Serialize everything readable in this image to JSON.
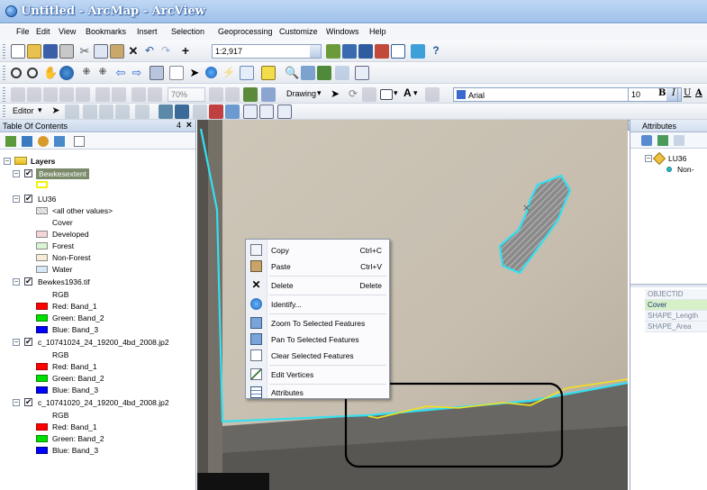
{
  "window": {
    "title": "Untitled - ArcMap - ArcView"
  },
  "menu": [
    "File",
    "Edit",
    "View",
    "Bookmarks",
    "Insert",
    "Selection",
    "Geoprocessing",
    "Customize",
    "Windows",
    "Help"
  ],
  "toolbar": {
    "scale_value": "1:2,917",
    "zoom_percent": "70%",
    "drawing_label": "Drawing",
    "font_name": "Arial",
    "font_size": "10",
    "bold": "B",
    "italic": "I",
    "underline": "U",
    "font_color_label": "A",
    "editor_label": "Editor"
  },
  "toc": {
    "title": "Table Of Contents",
    "pin": "4",
    "close": "×",
    "root_label": "Layers",
    "layers": [
      {
        "name": "Bewkesextent",
        "selected": true
      },
      {
        "name": "LU36",
        "other_values": "<all other values>",
        "field": "Cover",
        "classes": [
          {
            "label": "Developed",
            "color": "#f6d5d8"
          },
          {
            "label": "Forest",
            "color": "#d9f4d3"
          },
          {
            "label": "Non-Forest",
            "color": "#f8ecd6"
          },
          {
            "label": "Water",
            "color": "#d4e8f8"
          }
        ]
      },
      {
        "name": "Bewkes1936.tif",
        "rgb": "RGB",
        "bands": [
          {
            "label": "Red:  Band_1",
            "color": "#ff0000"
          },
          {
            "label": "Green: Band_2",
            "color": "#00e000"
          },
          {
            "label": "Blue:  Band_3",
            "color": "#0000ff"
          }
        ]
      },
      {
        "name": "c_10741024_24_19200_4bd_2008.jp2",
        "rgb": "RGB",
        "bands": [
          {
            "label": "Red:  Band_1",
            "color": "#ff0000"
          },
          {
            "label": "Green: Band_2",
            "color": "#00e000"
          },
          {
            "label": "Blue:  Band_3",
            "color": "#0000ff"
          }
        ]
      },
      {
        "name": "c_10741020_24_19200_4bd_2008.jp2",
        "rgb": "RGB",
        "bands": [
          {
            "label": "Red:  Band_1",
            "color": "#ff0000"
          },
          {
            "label": "Green: Band_2",
            "color": "#00e000"
          },
          {
            "label": "Blue:  Band_3",
            "color": "#0000ff"
          }
        ]
      }
    ]
  },
  "context_menu": [
    {
      "label": "Copy",
      "shortcut": "Ctrl+C",
      "icon": "copy-icon"
    },
    {
      "label": "Paste",
      "shortcut": "Ctrl+V",
      "icon": "paste-icon"
    },
    {
      "label": "Delete",
      "shortcut": "Delete",
      "icon": "delete-icon"
    },
    {
      "label": "Identify...",
      "shortcut": "",
      "icon": "identify-icon"
    },
    {
      "label": "Zoom To Selected Features",
      "shortcut": "",
      "icon": "zoom-to-selected-icon"
    },
    {
      "label": "Pan To Selected Features",
      "shortcut": "",
      "icon": "pan-to-selected-icon"
    },
    {
      "label": "Clear Selected Features",
      "shortcut": "",
      "icon": "clear-selection-icon"
    },
    {
      "label": "Edit Vertices",
      "shortcut": "",
      "icon": "edit-vertices-icon"
    },
    {
      "label": "Attributes",
      "shortcut": "",
      "icon": "attributes-icon"
    }
  ],
  "attributes": {
    "title": "Attributes",
    "tree_layer": "LU36",
    "tree_feature": "Non-",
    "fields": [
      "OBJECTID",
      "Cover",
      "SHAPE_Length",
      "SHAPE_Area"
    ]
  },
  "colors": {
    "selection": "#33e0f0",
    "extent_line": "#f5e21c",
    "annotation_box": "#000000"
  }
}
